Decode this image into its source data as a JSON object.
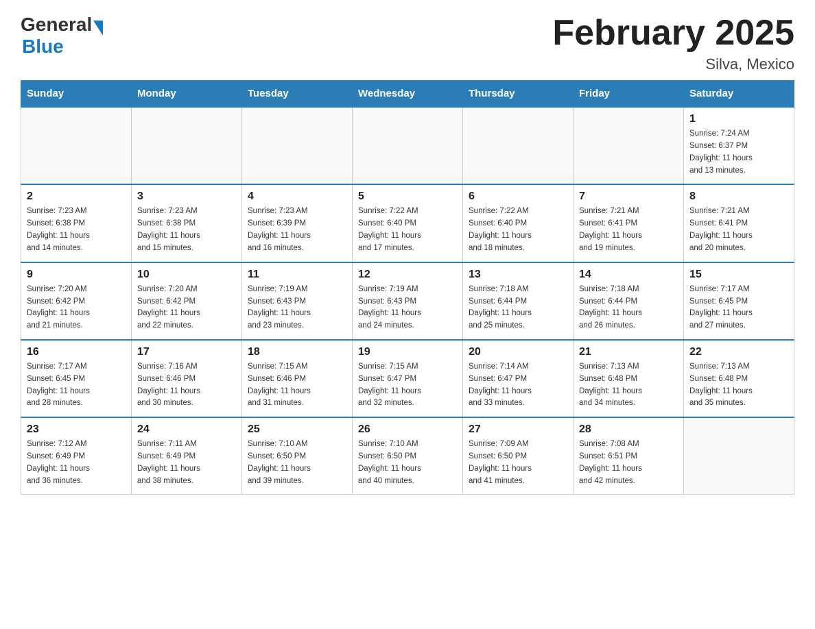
{
  "header": {
    "logo_general": "General",
    "logo_blue": "Blue",
    "title": "February 2025",
    "subtitle": "Silva, Mexico"
  },
  "weekdays": [
    "Sunday",
    "Monday",
    "Tuesday",
    "Wednesday",
    "Thursday",
    "Friday",
    "Saturday"
  ],
  "weeks": [
    [
      {
        "day": "",
        "info": ""
      },
      {
        "day": "",
        "info": ""
      },
      {
        "day": "",
        "info": ""
      },
      {
        "day": "",
        "info": ""
      },
      {
        "day": "",
        "info": ""
      },
      {
        "day": "",
        "info": ""
      },
      {
        "day": "1",
        "info": "Sunrise: 7:24 AM\nSunset: 6:37 PM\nDaylight: 11 hours\nand 13 minutes."
      }
    ],
    [
      {
        "day": "2",
        "info": "Sunrise: 7:23 AM\nSunset: 6:38 PM\nDaylight: 11 hours\nand 14 minutes."
      },
      {
        "day": "3",
        "info": "Sunrise: 7:23 AM\nSunset: 6:38 PM\nDaylight: 11 hours\nand 15 minutes."
      },
      {
        "day": "4",
        "info": "Sunrise: 7:23 AM\nSunset: 6:39 PM\nDaylight: 11 hours\nand 16 minutes."
      },
      {
        "day": "5",
        "info": "Sunrise: 7:22 AM\nSunset: 6:40 PM\nDaylight: 11 hours\nand 17 minutes."
      },
      {
        "day": "6",
        "info": "Sunrise: 7:22 AM\nSunset: 6:40 PM\nDaylight: 11 hours\nand 18 minutes."
      },
      {
        "day": "7",
        "info": "Sunrise: 7:21 AM\nSunset: 6:41 PM\nDaylight: 11 hours\nand 19 minutes."
      },
      {
        "day": "8",
        "info": "Sunrise: 7:21 AM\nSunset: 6:41 PM\nDaylight: 11 hours\nand 20 minutes."
      }
    ],
    [
      {
        "day": "9",
        "info": "Sunrise: 7:20 AM\nSunset: 6:42 PM\nDaylight: 11 hours\nand 21 minutes."
      },
      {
        "day": "10",
        "info": "Sunrise: 7:20 AM\nSunset: 6:42 PM\nDaylight: 11 hours\nand 22 minutes."
      },
      {
        "day": "11",
        "info": "Sunrise: 7:19 AM\nSunset: 6:43 PM\nDaylight: 11 hours\nand 23 minutes."
      },
      {
        "day": "12",
        "info": "Sunrise: 7:19 AM\nSunset: 6:43 PM\nDaylight: 11 hours\nand 24 minutes."
      },
      {
        "day": "13",
        "info": "Sunrise: 7:18 AM\nSunset: 6:44 PM\nDaylight: 11 hours\nand 25 minutes."
      },
      {
        "day": "14",
        "info": "Sunrise: 7:18 AM\nSunset: 6:44 PM\nDaylight: 11 hours\nand 26 minutes."
      },
      {
        "day": "15",
        "info": "Sunrise: 7:17 AM\nSunset: 6:45 PM\nDaylight: 11 hours\nand 27 minutes."
      }
    ],
    [
      {
        "day": "16",
        "info": "Sunrise: 7:17 AM\nSunset: 6:45 PM\nDaylight: 11 hours\nand 28 minutes."
      },
      {
        "day": "17",
        "info": "Sunrise: 7:16 AM\nSunset: 6:46 PM\nDaylight: 11 hours\nand 30 minutes."
      },
      {
        "day": "18",
        "info": "Sunrise: 7:15 AM\nSunset: 6:46 PM\nDaylight: 11 hours\nand 31 minutes."
      },
      {
        "day": "19",
        "info": "Sunrise: 7:15 AM\nSunset: 6:47 PM\nDaylight: 11 hours\nand 32 minutes."
      },
      {
        "day": "20",
        "info": "Sunrise: 7:14 AM\nSunset: 6:47 PM\nDaylight: 11 hours\nand 33 minutes."
      },
      {
        "day": "21",
        "info": "Sunrise: 7:13 AM\nSunset: 6:48 PM\nDaylight: 11 hours\nand 34 minutes."
      },
      {
        "day": "22",
        "info": "Sunrise: 7:13 AM\nSunset: 6:48 PM\nDaylight: 11 hours\nand 35 minutes."
      }
    ],
    [
      {
        "day": "23",
        "info": "Sunrise: 7:12 AM\nSunset: 6:49 PM\nDaylight: 11 hours\nand 36 minutes."
      },
      {
        "day": "24",
        "info": "Sunrise: 7:11 AM\nSunset: 6:49 PM\nDaylight: 11 hours\nand 38 minutes."
      },
      {
        "day": "25",
        "info": "Sunrise: 7:10 AM\nSunset: 6:50 PM\nDaylight: 11 hours\nand 39 minutes."
      },
      {
        "day": "26",
        "info": "Sunrise: 7:10 AM\nSunset: 6:50 PM\nDaylight: 11 hours\nand 40 minutes."
      },
      {
        "day": "27",
        "info": "Sunrise: 7:09 AM\nSunset: 6:50 PM\nDaylight: 11 hours\nand 41 minutes."
      },
      {
        "day": "28",
        "info": "Sunrise: 7:08 AM\nSunset: 6:51 PM\nDaylight: 11 hours\nand 42 minutes."
      },
      {
        "day": "",
        "info": ""
      }
    ]
  ]
}
